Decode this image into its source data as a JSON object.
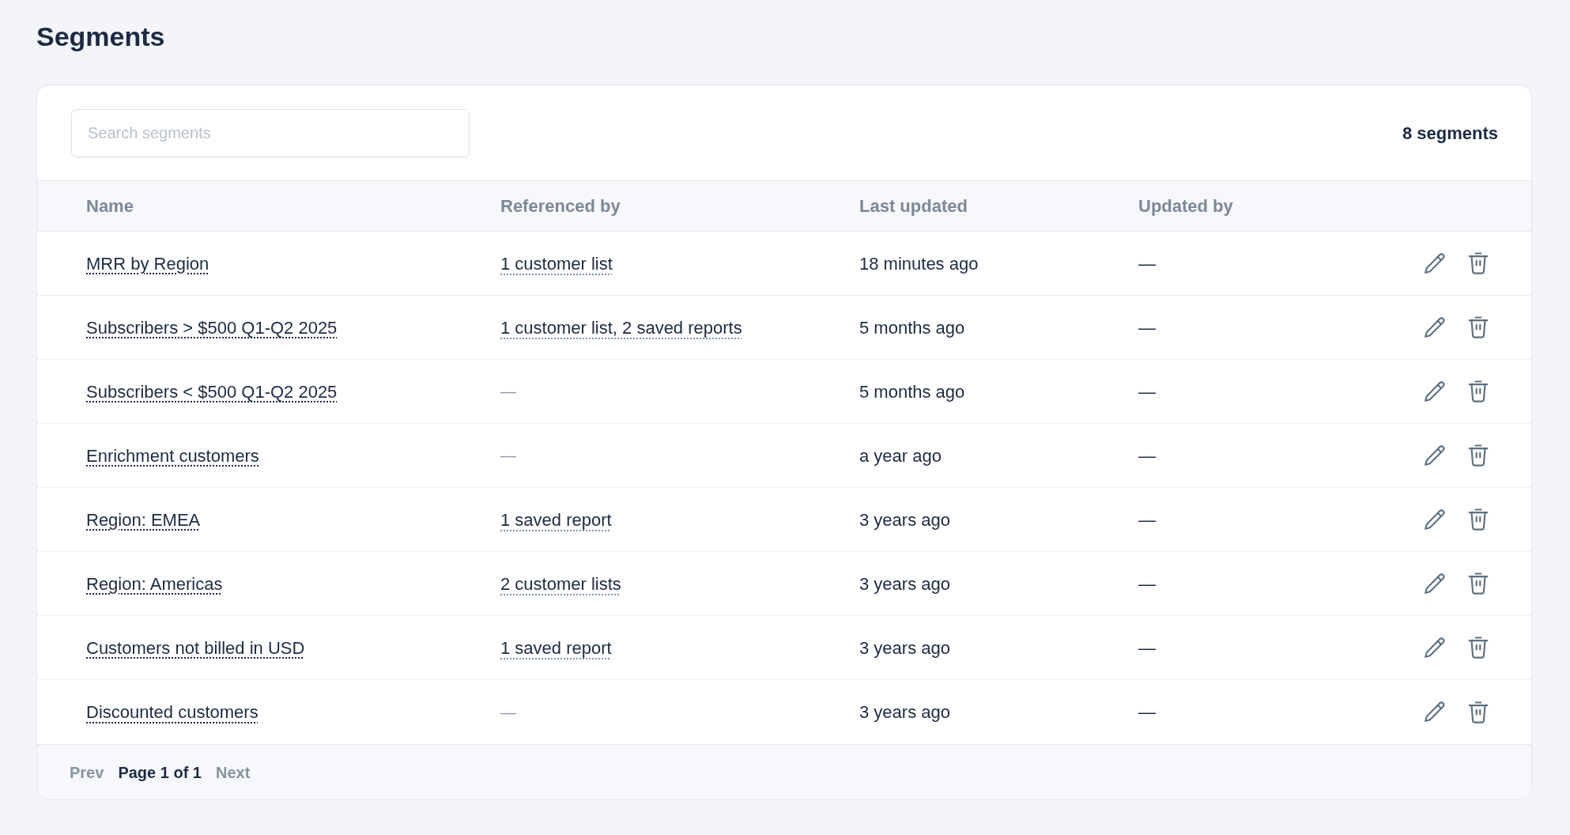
{
  "page": {
    "title": "Segments"
  },
  "toolbar": {
    "search": {
      "placeholder": "Search segments"
    },
    "count": "8 segments"
  },
  "table": {
    "columns": [
      "Name",
      "Referenced by",
      "Last updated",
      "Updated by"
    ],
    "rows": [
      {
        "name": "MRR by Region",
        "references": {
          "kind": "link",
          "text": "1 customer list"
        },
        "last_updated": "18 minutes ago",
        "updated_by": "—"
      },
      {
        "name": "Subscribers > $500 Q1-Q2 2025",
        "references": {
          "kind": "link",
          "text": "1 customer list, 2 saved reports"
        },
        "last_updated": "5 months ago",
        "updated_by": "—"
      },
      {
        "name": "Subscribers < $500 Q1-Q2 2025",
        "references": {
          "kind": "none",
          "text": "—"
        },
        "last_updated": "5 months ago",
        "updated_by": "—"
      },
      {
        "name": "Enrichment customers",
        "references": {
          "kind": "none",
          "text": "—"
        },
        "last_updated": "a year ago",
        "updated_by": "—"
      },
      {
        "name": "Region: EMEA",
        "references": {
          "kind": "link",
          "text": "1 saved report"
        },
        "last_updated": "3 years ago",
        "updated_by": "—"
      },
      {
        "name": "Region: Americas",
        "references": {
          "kind": "link",
          "text": "2 customer lists"
        },
        "last_updated": "3 years ago",
        "updated_by": "—"
      },
      {
        "name": "Customers not billed in USD",
        "references": {
          "kind": "link",
          "text": "1 saved report"
        },
        "last_updated": "3 years ago",
        "updated_by": "—"
      },
      {
        "name": "Discounted customers",
        "references": {
          "kind": "none",
          "text": "—"
        },
        "last_updated": "3 years ago",
        "updated_by": "—"
      }
    ]
  },
  "pagination": {
    "prev": {
      "label": "Prev",
      "disabled": true
    },
    "status": "Page 1 of 1",
    "next": {
      "label": "Next",
      "disabled": true
    }
  }
}
